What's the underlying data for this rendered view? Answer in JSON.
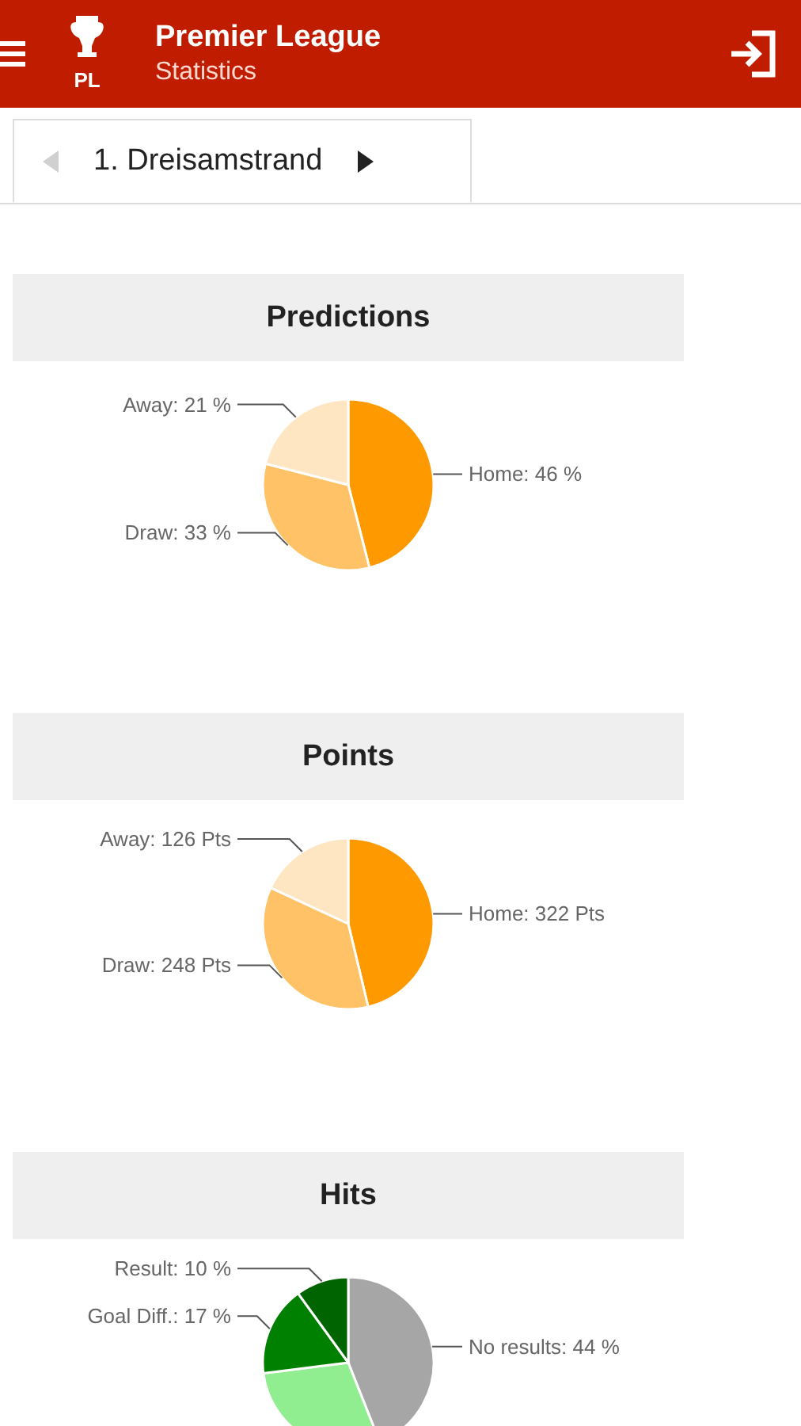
{
  "app_bar": {
    "title": "Premier League",
    "subtitle": "Statistics",
    "logo_text": "PL"
  },
  "tab": {
    "label": "1. Dreisamstrand",
    "prev_disabled": true,
    "next_disabled": false
  },
  "sections": [
    {
      "title": "Predictions",
      "chart_data": {
        "type": "pie",
        "values": [
          46,
          33,
          21
        ],
        "colors": [
          "#ff9900",
          "#ffc266",
          "#ffe6c2"
        ],
        "value_labels": [
          "Home: 46 %",
          "Draw: 33 %",
          "Away: 21 %"
        ]
      }
    },
    {
      "title": "Points",
      "chart_data": {
        "type": "pie",
        "values": [
          322,
          248,
          126
        ],
        "colors": [
          "#ff9900",
          "#ffc266",
          "#ffe6c2"
        ],
        "value_labels": [
          "Home: 322 Pts",
          "Draw: 248 Pts",
          "Away: 126 Pts"
        ]
      }
    },
    {
      "title": "Hits",
      "chart_data": {
        "type": "pie",
        "values": [
          44,
          29,
          17,
          10
        ],
        "colors": [
          "#a6a6a6",
          "#90ee90",
          "#008000",
          "#006400"
        ],
        "value_labels": [
          "No results: 44 %",
          null,
          "Goal Diff.: 17 %",
          "Result: 10 %"
        ]
      }
    }
  ]
}
